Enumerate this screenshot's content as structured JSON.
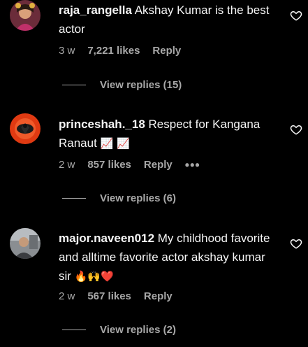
{
  "comments": [
    {
      "username": "raja_rangella",
      "text": "Akshay Kumar is the best actor",
      "time": "3 w",
      "likes": "7,221 likes",
      "reply": "Reply",
      "view_replies": "View replies (15)"
    },
    {
      "username": "princeshah._18",
      "text": "Respect for Kangana Ranaut",
      "emojis": "📈 📈",
      "time": "2 w",
      "likes": "857 likes",
      "reply": "Reply",
      "more": "•••",
      "view_replies": "View replies (6)"
    },
    {
      "username": "major.naveen012",
      "text": "My childhood favorite and alltime favorite actor akshay kumar sir",
      "emojis": "🔥🙌❤️",
      "time": "2 w",
      "likes": "567 likes",
      "reply": "Reply",
      "view_replies": "View replies (2)"
    }
  ],
  "colors": {
    "background": "#000000",
    "primary_text": "#f5f5f5",
    "secondary_text": "#a8a8a8"
  },
  "icons": {
    "like": "heart-outline-icon"
  }
}
